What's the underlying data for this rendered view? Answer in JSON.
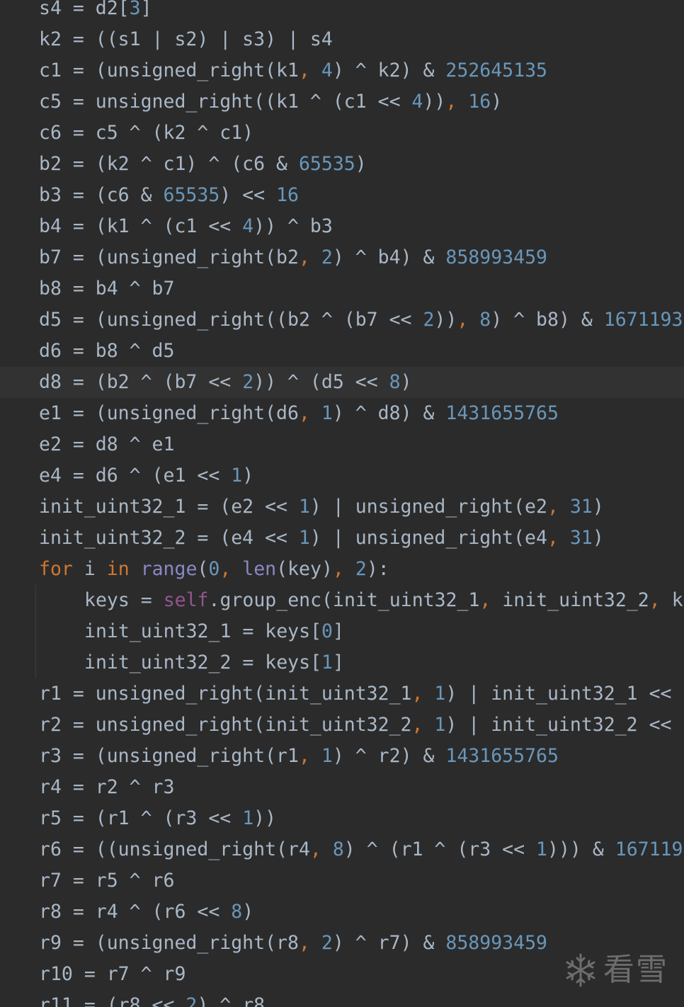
{
  "editor": {
    "language": "python",
    "first_line_partial": true,
    "last_line_partial": true,
    "current_line_index": 12,
    "lines": [
      {
        "indent": 1,
        "tokens": [
          [
            "v",
            "s4 = d2["
          ],
          [
            "n",
            "3"
          ],
          [
            "v",
            "]"
          ]
        ]
      },
      {
        "indent": 1,
        "tokens": [
          [
            "v",
            "k2 = ((s1 | s2) | s3) | s4"
          ]
        ]
      },
      {
        "indent": 1,
        "tokens": [
          [
            "v",
            "c1 = (unsigned_right(k1"
          ],
          [
            "c",
            ", "
          ],
          [
            "n",
            "4"
          ],
          [
            "v",
            ") ^ k2) & "
          ],
          [
            "n",
            "252645135"
          ]
        ]
      },
      {
        "indent": 1,
        "tokens": [
          [
            "v",
            "c5 = unsigned_right((k1 ^ (c1 << "
          ],
          [
            "n",
            "4"
          ],
          [
            "v",
            "))"
          ],
          [
            "c",
            ", "
          ],
          [
            "n",
            "16"
          ],
          [
            "v",
            ")"
          ]
        ]
      },
      {
        "indent": 1,
        "tokens": [
          [
            "v",
            "c6 = c5 ^ (k2 ^ c1)"
          ]
        ]
      },
      {
        "indent": 1,
        "tokens": [
          [
            "v",
            "b2 = (k2 ^ c1) ^ (c6 & "
          ],
          [
            "n",
            "65535"
          ],
          [
            "v",
            ")"
          ]
        ]
      },
      {
        "indent": 1,
        "tokens": [
          [
            "v",
            "b3 = (c6 & "
          ],
          [
            "n",
            "65535"
          ],
          [
            "v",
            ") << "
          ],
          [
            "n",
            "16"
          ]
        ]
      },
      {
        "indent": 1,
        "tokens": [
          [
            "v",
            "b4 = (k1 ^ (c1 << "
          ],
          [
            "n",
            "4"
          ],
          [
            "v",
            ")) ^ b3"
          ]
        ]
      },
      {
        "indent": 1,
        "tokens": [
          [
            "v",
            "b7 = (unsigned_right(b2"
          ],
          [
            "c",
            ", "
          ],
          [
            "n",
            "2"
          ],
          [
            "v",
            ") ^ b4) & "
          ],
          [
            "n",
            "858993459"
          ]
        ]
      },
      {
        "indent": 1,
        "tokens": [
          [
            "v",
            "b8 = b4 ^ b7"
          ]
        ]
      },
      {
        "indent": 1,
        "tokens": [
          [
            "v",
            "d5 = (unsigned_right((b2 ^ (b7 << "
          ],
          [
            "n",
            "2"
          ],
          [
            "v",
            "))"
          ],
          [
            "c",
            ", "
          ],
          [
            "n",
            "8"
          ],
          [
            "v",
            ") ^ b8) & "
          ],
          [
            "n",
            "1671193"
          ]
        ]
      },
      {
        "indent": 1,
        "tokens": [
          [
            "v",
            "d6 = b8 ^ d5"
          ]
        ]
      },
      {
        "indent": 1,
        "tokens": [
          [
            "v",
            "d8 = (b2 ^ (b7 << "
          ],
          [
            "n",
            "2"
          ],
          [
            "v",
            ")) ^ (d5 << "
          ],
          [
            "n",
            "8"
          ],
          [
            "v",
            ")"
          ]
        ]
      },
      {
        "indent": 1,
        "tokens": [
          [
            "v",
            "e1 = (unsigned_right(d6"
          ],
          [
            "c",
            ", "
          ],
          [
            "n",
            "1"
          ],
          [
            "v",
            ") ^ d8) & "
          ],
          [
            "n",
            "1431655765"
          ]
        ]
      },
      {
        "indent": 1,
        "tokens": [
          [
            "v",
            "e2 = d8 ^ e1"
          ]
        ]
      },
      {
        "indent": 1,
        "tokens": [
          [
            "v",
            "e4 = d6 ^ (e1 << "
          ],
          [
            "n",
            "1"
          ],
          [
            "v",
            ")"
          ]
        ]
      },
      {
        "indent": 1,
        "tokens": [
          [
            "v",
            "init_uint32_1 = (e2 << "
          ],
          [
            "n",
            "1"
          ],
          [
            "v",
            ") | unsigned_right(e2"
          ],
          [
            "c",
            ", "
          ],
          [
            "n",
            "31"
          ],
          [
            "v",
            ")"
          ]
        ]
      },
      {
        "indent": 1,
        "tokens": [
          [
            "v",
            "init_uint32_2 = (e4 << "
          ],
          [
            "n",
            "1"
          ],
          [
            "v",
            ") | unsigned_right(e4"
          ],
          [
            "c",
            ", "
          ],
          [
            "n",
            "31"
          ],
          [
            "v",
            ")"
          ]
        ]
      },
      {
        "indent": 1,
        "tokens": [
          [
            "k",
            "for "
          ],
          [
            "v",
            "i "
          ],
          [
            "k",
            "in "
          ],
          [
            "b",
            "range"
          ],
          [
            "v",
            "("
          ],
          [
            "n",
            "0"
          ],
          [
            "c",
            ", "
          ],
          [
            "b",
            "len"
          ],
          [
            "v",
            "(key)"
          ],
          [
            "c",
            ", "
          ],
          [
            "n",
            "2"
          ],
          [
            "v",
            "):"
          ]
        ]
      },
      {
        "indent": 2,
        "tokens": [
          [
            "v",
            "keys = "
          ],
          [
            "s",
            "self"
          ],
          [
            "v",
            ".group_enc(init_uint32_1"
          ],
          [
            "c",
            ", "
          ],
          [
            "v",
            "init_uint32_2"
          ],
          [
            "c",
            ", "
          ],
          [
            "v",
            "k"
          ]
        ]
      },
      {
        "indent": 2,
        "tokens": [
          [
            "v",
            "init_uint32_1 = keys["
          ],
          [
            "n",
            "0"
          ],
          [
            "v",
            "]"
          ]
        ]
      },
      {
        "indent": 2,
        "tokens": [
          [
            "v",
            "init_uint32_2 = keys["
          ],
          [
            "n",
            "1"
          ],
          [
            "v",
            "]"
          ]
        ]
      },
      {
        "indent": 1,
        "tokens": [
          [
            "v",
            "r1 = unsigned_right(init_uint32_1"
          ],
          [
            "c",
            ", "
          ],
          [
            "n",
            "1"
          ],
          [
            "v",
            ") | init_uint32_1 <<"
          ]
        ]
      },
      {
        "indent": 1,
        "tokens": [
          [
            "v",
            "r2 = unsigned_right(init_uint32_2"
          ],
          [
            "c",
            ", "
          ],
          [
            "n",
            "1"
          ],
          [
            "v",
            ") | init_uint32_2 <<"
          ]
        ]
      },
      {
        "indent": 1,
        "tokens": [
          [
            "v",
            "r3 = (unsigned_right(r1"
          ],
          [
            "c",
            ", "
          ],
          [
            "n",
            "1"
          ],
          [
            "v",
            ") ^ r2) & "
          ],
          [
            "n",
            "1431655765"
          ]
        ]
      },
      {
        "indent": 1,
        "tokens": [
          [
            "v",
            "r4 = r2 ^ r3"
          ]
        ]
      },
      {
        "indent": 1,
        "tokens": [
          [
            "v",
            "r5 = (r1 ^ (r3 << "
          ],
          [
            "n",
            "1"
          ],
          [
            "v",
            "))"
          ]
        ]
      },
      {
        "indent": 1,
        "tokens": [
          [
            "v",
            "r6 = ((unsigned_right(r4"
          ],
          [
            "c",
            ", "
          ],
          [
            "n",
            "8"
          ],
          [
            "v",
            ") ^ (r1 ^ (r3 << "
          ],
          [
            "n",
            "1"
          ],
          [
            "v",
            "))) & "
          ],
          [
            "n",
            "167119"
          ]
        ]
      },
      {
        "indent": 1,
        "tokens": [
          [
            "v",
            "r7 = r5 ^ r6"
          ]
        ]
      },
      {
        "indent": 1,
        "tokens": [
          [
            "v",
            "r8 = r4 ^ (r6 << "
          ],
          [
            "n",
            "8"
          ],
          [
            "v",
            ")"
          ]
        ]
      },
      {
        "indent": 1,
        "tokens": [
          [
            "v",
            "r9 = (unsigned_right(r8"
          ],
          [
            "c",
            ", "
          ],
          [
            "n",
            "2"
          ],
          [
            "v",
            ") ^ r7) & "
          ],
          [
            "n",
            "858993459"
          ]
        ]
      },
      {
        "indent": 1,
        "tokens": [
          [
            "v",
            "r10 = r7 ^ r9"
          ]
        ]
      },
      {
        "indent": 1,
        "tokens": [
          [
            "v",
            "r11 = (r8 << "
          ],
          [
            "n",
            "2"
          ],
          [
            "v",
            ") ^ r8"
          ]
        ]
      }
    ]
  },
  "watermark": {
    "text": "看雪",
    "icon": "snowflake-icon"
  },
  "colors": {
    "background": "#2b2b2b",
    "current_line": "#323232",
    "identifier": "#a9b7c6",
    "number": "#6897bb",
    "keyword": "#cc7832",
    "comma": "#cc7832",
    "builtin": "#8888c6",
    "self": "#94558d"
  }
}
